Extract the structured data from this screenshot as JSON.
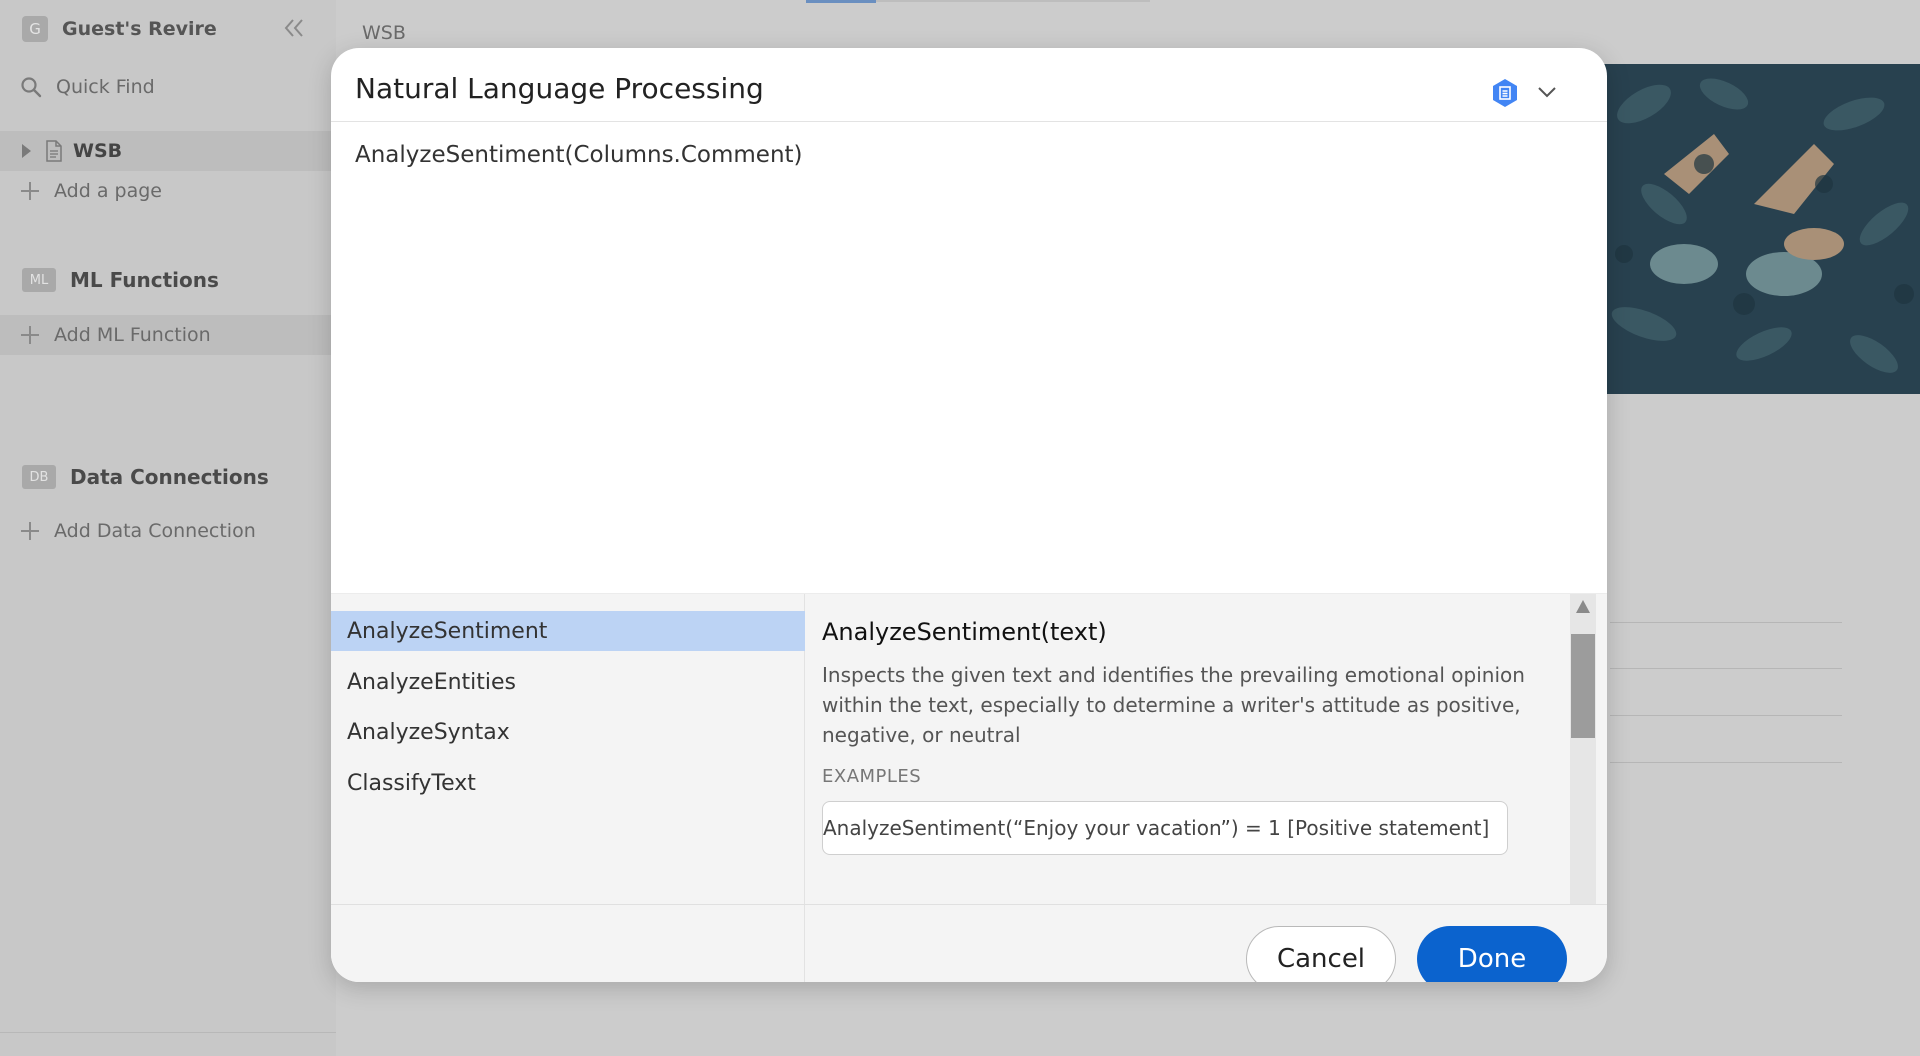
{
  "sidebar": {
    "workspace_badge": "G",
    "workspace_name": "Guest's Revire",
    "quick_find_label": "Quick Find",
    "page_label": "WSB",
    "add_page_label": "Add a page",
    "ml_section": {
      "badge": "ML",
      "title": "ML Functions",
      "add_label": "Add ML Function"
    },
    "data_section": {
      "badge": "DB",
      "title": "Data Connections",
      "add_label": "Add Data Connection"
    }
  },
  "main": {
    "breadcrumb": "WSB"
  },
  "modal": {
    "title": "Natural Language Processing",
    "expression": "AnalyzeSentiment(Columns.Comment)",
    "functions": [
      {
        "label": "AnalyzeSentiment",
        "selected": true
      },
      {
        "label": "AnalyzeEntities",
        "selected": false
      },
      {
        "label": "AnalyzeSyntax",
        "selected": false
      },
      {
        "label": "ClassifyText",
        "selected": false
      }
    ],
    "detail": {
      "signature": "AnalyzeSentiment(text)",
      "description": "Inspects the given text and identifies the prevailing emotional opinion within the text, especially to determine a writer's attitude as positive, negative, or neutral",
      "examples_label": "EXAMPLES",
      "example": "AnalyzeSentiment(“Enjoy your vacation”) = 1 [Positive statement]"
    },
    "cancel_label": "Cancel",
    "done_label": "Done"
  },
  "colors": {
    "primary_button": "#0b63ce",
    "selected_row": "#bcd3f4",
    "api_icon": "#4285f4"
  }
}
